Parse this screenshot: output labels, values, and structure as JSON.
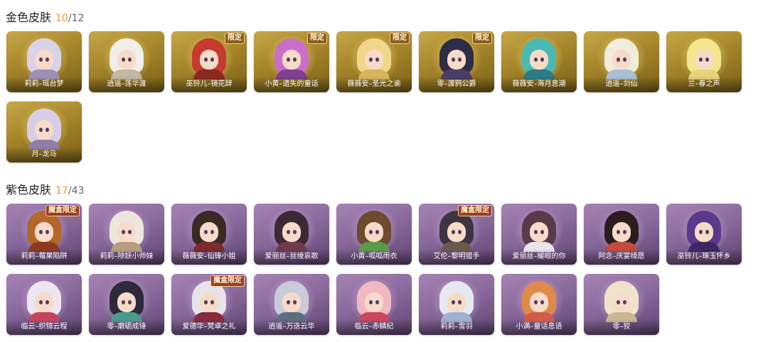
{
  "sections": [
    {
      "title": "金色皮肤",
      "owned": "10",
      "separator": "/",
      "total": "12",
      "skins": [
        {
          "name": "莉莉–瑶台梦",
          "badge": "",
          "hair": "#d8d3e6",
          "cloth": "#9d8fb3"
        },
        {
          "name": "逍遥–莲华渡",
          "badge": "",
          "hair": "#f1efe9",
          "cloth": "#c3b8a3"
        },
        {
          "name": "巫铃儿–镜花辞",
          "badge": "限定",
          "hair": "#c73a2f",
          "cloth": "#8a2a22"
        },
        {
          "name": "小黄–遗失的童话",
          "badge": "限定",
          "hair": "#c96ec9",
          "cloth": "#7f3f91"
        },
        {
          "name": "薇薇安–圣光之谕",
          "badge": "限定",
          "hair": "#f2d68a",
          "cloth": "#d8b45a"
        },
        {
          "name": "零–渡鸦公爵",
          "badge": "限定",
          "hair": "#2f2c45",
          "cloth": "#4a3e66"
        },
        {
          "name": "薇薇安–海月息潮",
          "badge": "",
          "hair": "#49b9b4",
          "cloth": "#2d7a86"
        },
        {
          "name": "逍遥–剑仙",
          "badge": "",
          "hair": "#f0eddc",
          "cloth": "#a9c0d3"
        },
        {
          "name": "兰–春之声",
          "badge": "",
          "hair": "#f4e58e",
          "cloth": "#e6d27a"
        },
        {
          "name": "月–龙马",
          "badge": "",
          "hair": "#d8cde6",
          "cloth": "#8f7fa8"
        }
      ]
    },
    {
      "title": "紫色皮肤",
      "owned": "17",
      "separator": "/",
      "total": "43",
      "skins": [
        {
          "name": "莉莉–莓果陷阱",
          "badge": "魔盒限定",
          "hair": "#b4672a",
          "cloth": "#8c3a1f"
        },
        {
          "name": "莉莉–除妖小师妹",
          "badge": "",
          "hair": "#ece6dc",
          "cloth": "#b59d7e"
        },
        {
          "name": "薇薇安–仙锋小姐",
          "badge": "",
          "hair": "#3a2a24",
          "cloth": "#7a2b2b"
        },
        {
          "name": "爱丽丝–丝绫哀歌",
          "badge": "",
          "hair": "#3b2a33",
          "cloth": "#6d3b4b"
        },
        {
          "name": "小黄–呱呱雨衣",
          "badge": "",
          "hair": "#6e4a2e",
          "cloth": "#5c9a4a"
        },
        {
          "name": "艾伦–黎明猎手",
          "badge": "魔盒限定",
          "hair": "#3d3640",
          "cloth": "#6a5a4e"
        },
        {
          "name": "爱丽丝–耀眼的你",
          "badge": "",
          "hair": "#5a3a4a",
          "cloth": "#e9e4ea"
        },
        {
          "name": "阿念–庆宴绮愿",
          "badge": "",
          "hair": "#2b1d1d",
          "cloth": "#c24a3e"
        },
        {
          "name": "巫铃儿–琢玉怀乡",
          "badge": "",
          "hair": "#5a3a8a",
          "cloth": "#3d2866"
        },
        {
          "name": "临云–织锦云程",
          "badge": "",
          "hair": "#ebe6ef",
          "cloth": "#c8435a"
        },
        {
          "name": "零–磨砺成锋",
          "badge": "",
          "hair": "#2e2a3a",
          "cloth": "#4a9a8e"
        },
        {
          "name": "爱德华–梵卓之礼",
          "badge": "魔盒限定",
          "hair": "#e6e4ea",
          "cloth": "#8a2a3a"
        },
        {
          "name": "逍遥–万迭云华",
          "badge": "",
          "hair": "#c9ccd8",
          "cloth": "#5f6e7e"
        },
        {
          "name": "临云–赤鳞纪",
          "badge": "",
          "hair": "#f2b8c2",
          "cloth": "#c9475b"
        },
        {
          "name": "莉莉–雪羽",
          "badge": "",
          "hair": "#e6e9f2",
          "cloth": "#9eb1d1"
        },
        {
          "name": "小满–童话息语",
          "badge": "",
          "hair": "#e08a4a",
          "cloth": "#d45a4a"
        },
        {
          "name": "零–狡",
          "badge": "",
          "hair": "#efe3c9",
          "cloth": "#c9b890"
        }
      ]
    }
  ]
}
